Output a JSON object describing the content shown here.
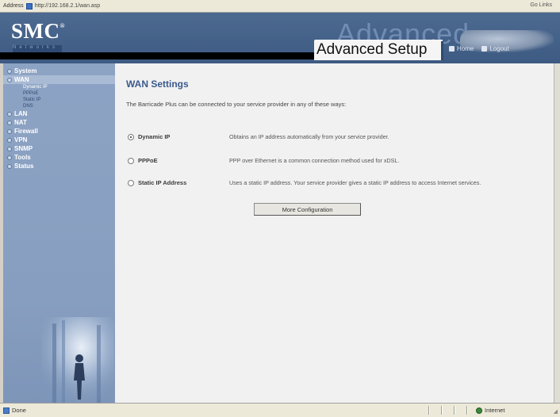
{
  "browser": {
    "address_label": "Address",
    "url": "http://192.168.2.1/wan.asp",
    "right_text": "Go Links"
  },
  "header": {
    "brand": "SMC",
    "brand_mark": "®",
    "brand_sub": "Networks",
    "ghost_title": "Advanced",
    "title": "Advanced Setup",
    "home_label": "Home",
    "logout_label": "Logout"
  },
  "sidebar": {
    "items": [
      {
        "label": "System"
      },
      {
        "label": "WAN"
      },
      {
        "label": "LAN"
      },
      {
        "label": "NAT"
      },
      {
        "label": "Firewall"
      },
      {
        "label": "VPN"
      },
      {
        "label": "SNMP"
      },
      {
        "label": "Tools"
      },
      {
        "label": "Status"
      }
    ],
    "wan_subitems": [
      {
        "label": "Dynamic IP"
      },
      {
        "label": "PPPoE"
      },
      {
        "label": "Static IP"
      },
      {
        "label": "DNS"
      }
    ]
  },
  "main": {
    "title": "WAN Settings",
    "intro": "The Barricade Plus can be connected to your service provider in any of these ways:",
    "options": [
      {
        "label": "Dynamic IP",
        "description": "Obtains an IP address automatically from your service provider.",
        "checked": true
      },
      {
        "label": "PPPoE",
        "description": "PPP over Ethernet is a common connection method used for xDSL.",
        "checked": false
      },
      {
        "label": "Static IP Address",
        "description": "Uses a static IP address. Your service provider gives a static IP address to access Internet services.",
        "checked": false
      }
    ],
    "more_button": "More Configuration"
  },
  "statusbar": {
    "left": "Done",
    "right": "Internet"
  },
  "colors": {
    "header_bg": "#3d5a82",
    "sidebar_bg": "#8da3c4",
    "title_blue": "#3a5a8c",
    "content_bg": "#f1f1f1"
  }
}
